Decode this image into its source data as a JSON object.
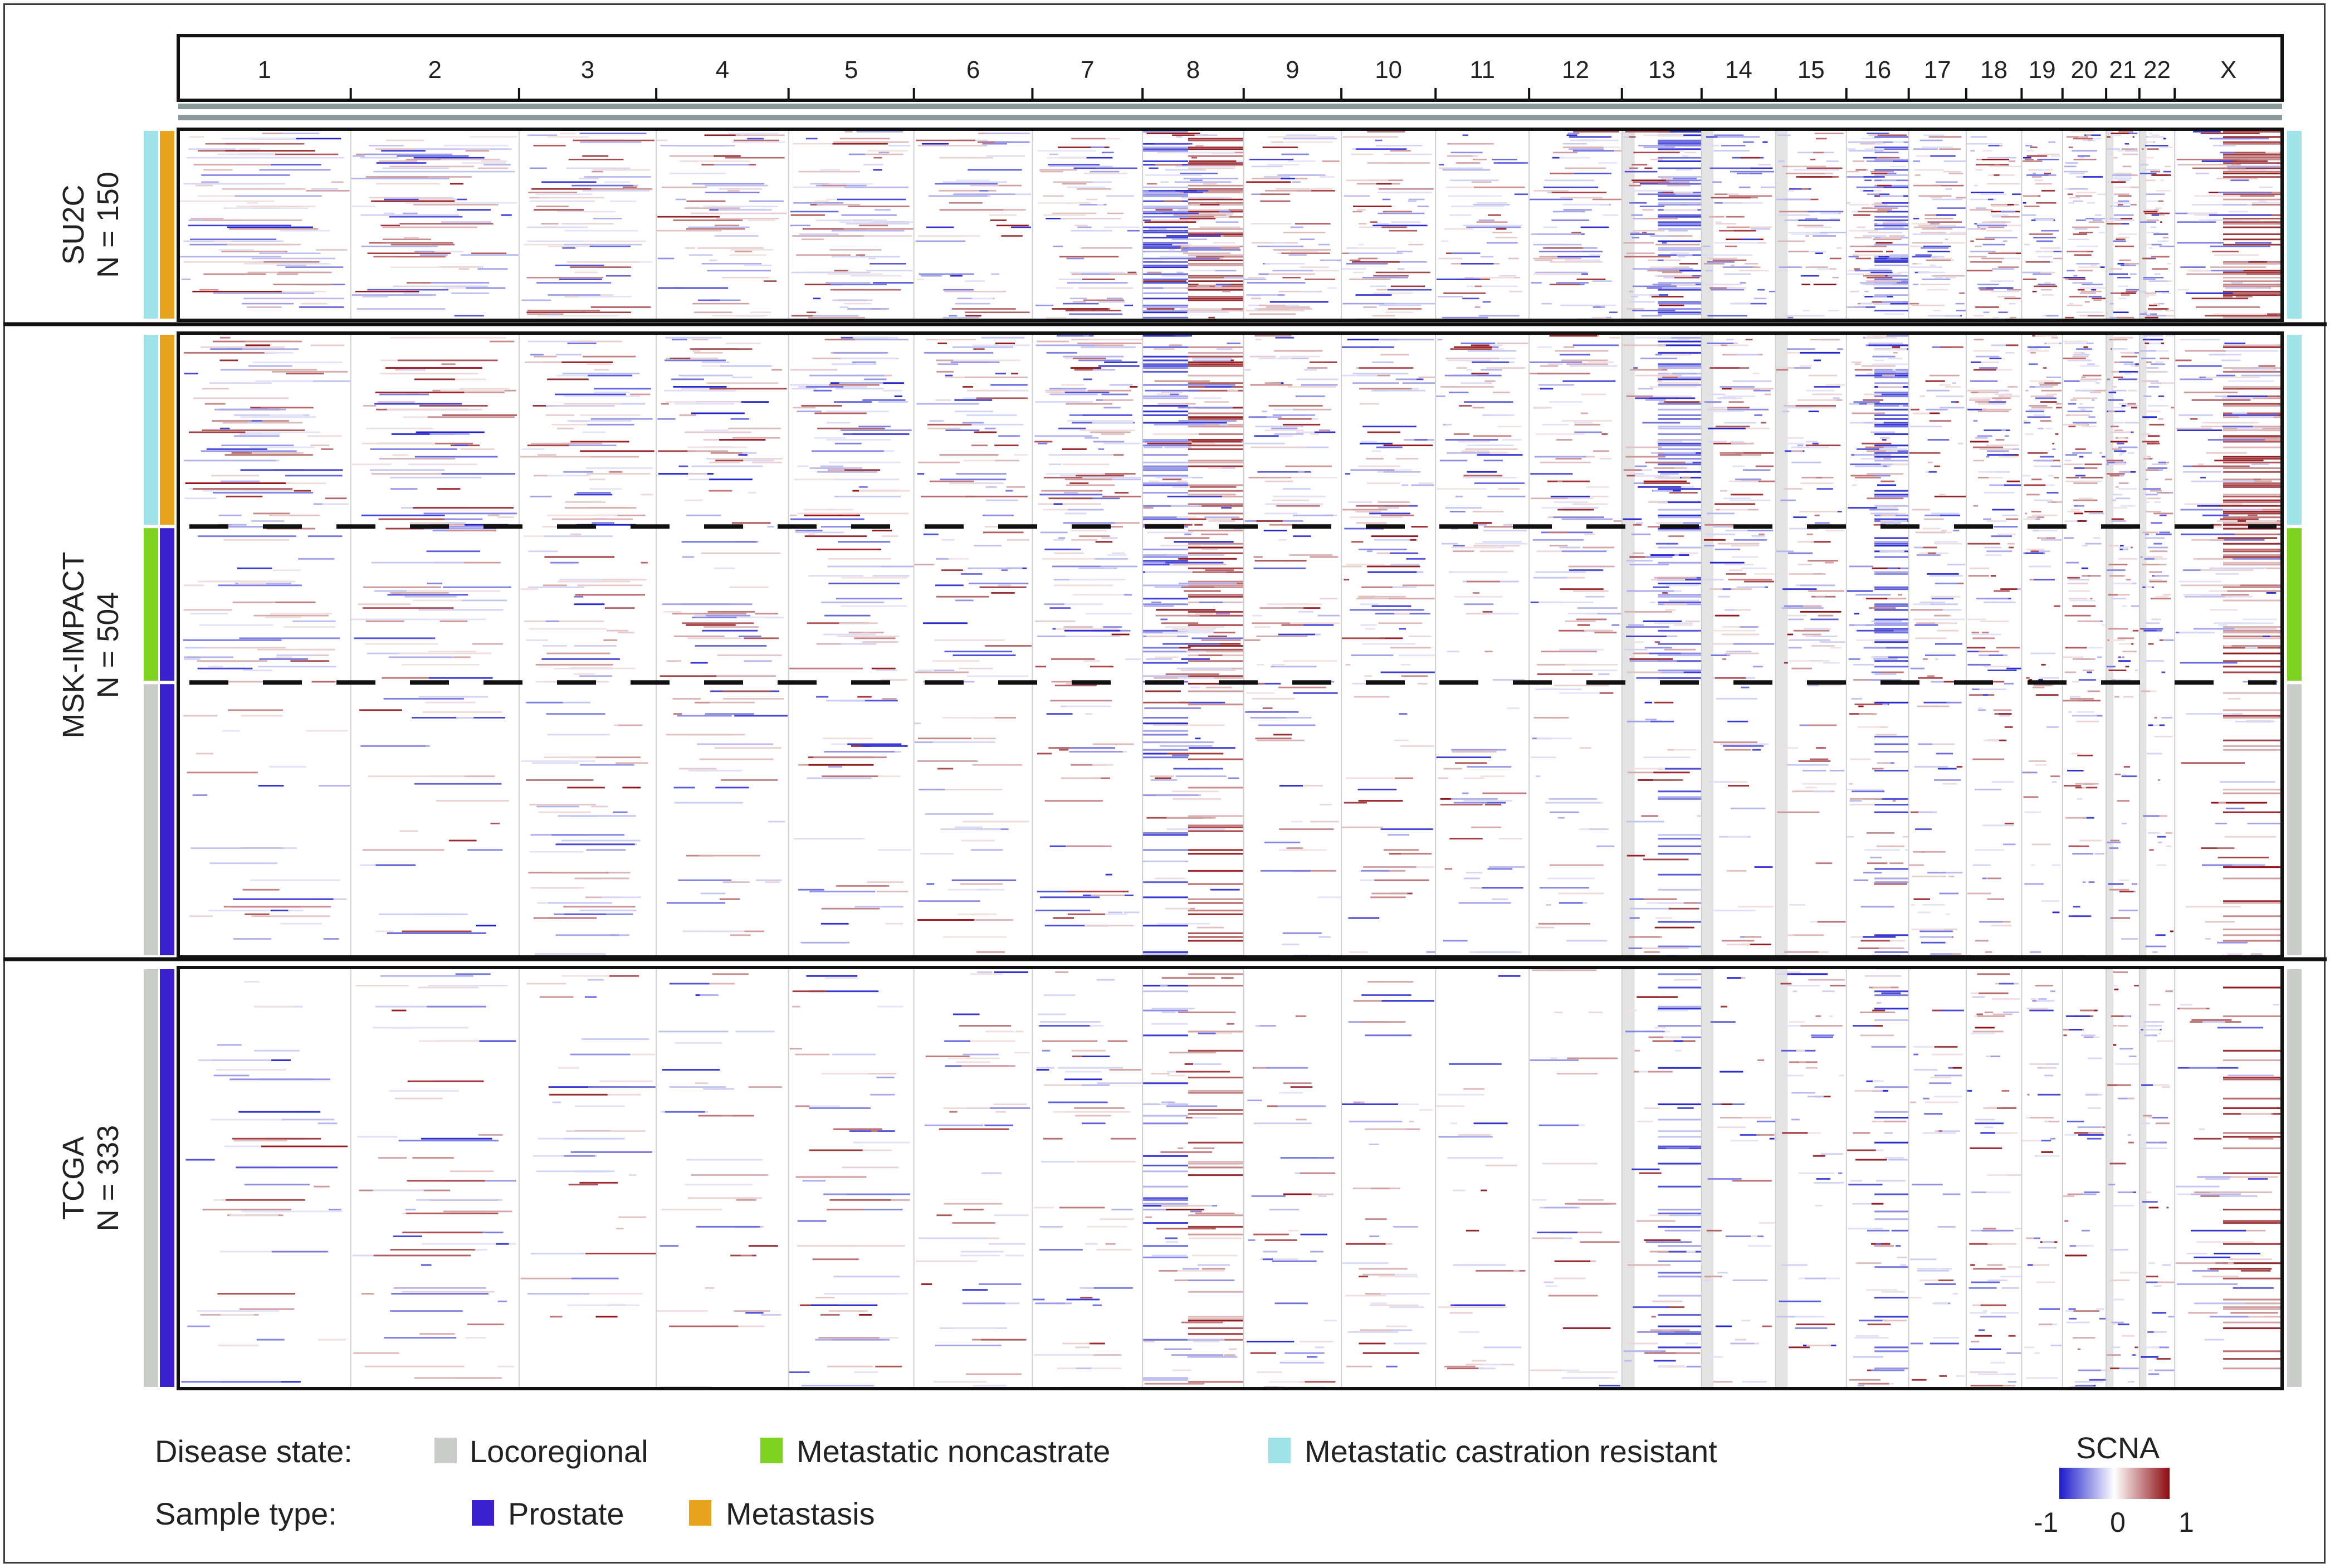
{
  "colors": {
    "locoregional": "#c8cdc8",
    "metastatic_noncastrate": "#7ed321",
    "metastatic_castration_resistant": "#9fe3e8",
    "prostate": "#3a1fcf",
    "metastasis": "#e8a31e",
    "loss": "#1a1acc",
    "gain": "#8b0b10",
    "neutral": "#ffffff",
    "acrocentric_shade": "#e3e3e3"
  },
  "chart_data": {
    "type": "heatmap",
    "x_axis": {
      "chromosomes": [
        "1",
        "2",
        "3",
        "4",
        "5",
        "6",
        "7",
        "8",
        "9",
        "10",
        "11",
        "12",
        "13",
        "14",
        "15",
        "16",
        "17",
        "18",
        "19",
        "20",
        "21",
        "22",
        "X"
      ],
      "relative_length": [
        249,
        243,
        198,
        191,
        181,
        171,
        159,
        146,
        141,
        136,
        135,
        134,
        115,
        107,
        102,
        90,
        83,
        80,
        59,
        63,
        48,
        51,
        155
      ]
    },
    "cohorts": [
      {
        "name": "SU2C",
        "n_label": "N = 150",
        "n": 150,
        "groups": [
          {
            "disease_state": "metastatic_castration_resistant",
            "sample_type": "metastasis",
            "fraction": 1.0
          }
        ]
      },
      {
        "name": "MSK-IMPACT",
        "n_label": "N = 504",
        "n": 504,
        "groups": [
          {
            "disease_state": "metastatic_castration_resistant",
            "sample_type": "metastasis",
            "fraction": 0.31
          },
          {
            "disease_state": "metastatic_noncastrate",
            "sample_type": "prostate",
            "fraction": 0.25
          },
          {
            "disease_state": "locoregional",
            "sample_type": "prostate",
            "fraction": 0.44
          }
        ]
      },
      {
        "name": "TCGA",
        "n_label": "N = 333",
        "n": 333,
        "groups": [
          {
            "disease_state": "locoregional",
            "sample_type": "prostate",
            "fraction": 1.0
          }
        ]
      }
    ],
    "color_scale": {
      "title": "SCNA",
      "min": -1,
      "mid": 0,
      "max": 1,
      "ticks": [
        "-1",
        "0",
        "1"
      ]
    },
    "recurrent_events": [
      {
        "chromosome": "8",
        "arm": "p",
        "direction": "loss"
      },
      {
        "chromosome": "8",
        "arm": "q",
        "direction": "gain"
      },
      {
        "chromosome": "13",
        "arm": "q",
        "direction": "loss"
      },
      {
        "chromosome": "16",
        "arm": "q",
        "direction": "loss"
      },
      {
        "chromosome": "X",
        "arm": "q",
        "direction": "gain"
      }
    ]
  },
  "legend": {
    "disease_state_label": "Disease state:",
    "disease_states": [
      {
        "key": "locoregional",
        "label": "Locoregional"
      },
      {
        "key": "metastatic_noncastrate",
        "label": "Metastatic noncastrate"
      },
      {
        "key": "metastatic_castration_resistant",
        "label": "Metastatic castration resistant"
      }
    ],
    "sample_type_label": "Sample type:",
    "sample_types": [
      {
        "key": "prostate",
        "label": "Prostate"
      },
      {
        "key": "metastasis",
        "label": "Metastasis"
      }
    ]
  }
}
